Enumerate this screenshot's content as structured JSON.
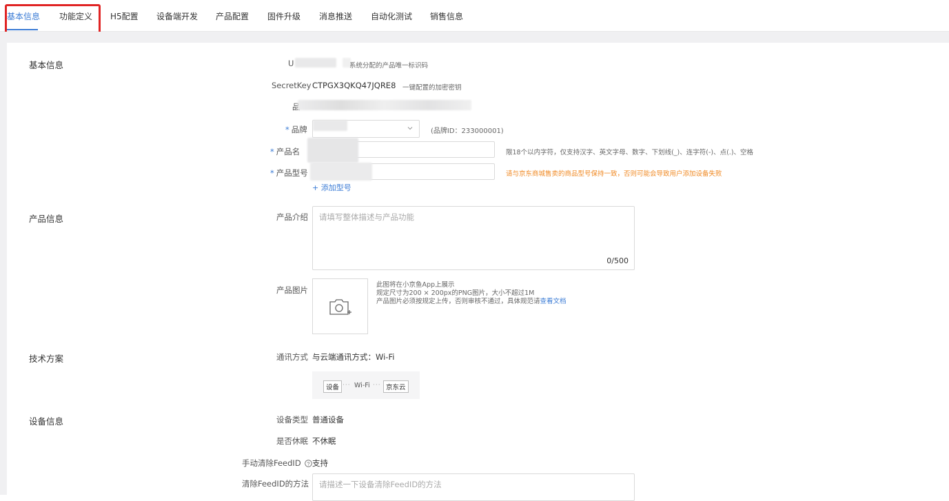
{
  "tabs": [
    {
      "label": "基本信息",
      "active": true
    },
    {
      "label": "功能定义"
    },
    {
      "label": "H5配置"
    },
    {
      "label": "设备端开发"
    },
    {
      "label": "产品配置"
    },
    {
      "label": "固件升级"
    },
    {
      "label": "消息推送"
    },
    {
      "label": "自动化测试"
    },
    {
      "label": "销售信息"
    }
  ],
  "sections": {
    "basic": "基本信息",
    "product": "产品信息",
    "tech": "技术方案",
    "device": "设备信息"
  },
  "basic": {
    "uuid_label": "U",
    "uuid_hint": "系统分配的产品唯一标识码",
    "secret_label": "SecretKey",
    "secret_value": "CTPGX3QKQ47JQRE8",
    "secret_hint": "一键配置的加密密钥",
    "category_label": "品",
    "brand_required": "*",
    "brand_label": "品牌",
    "brand_id": "(品牌ID：233000001)",
    "name_required": "*",
    "name_label": "产品名",
    "name_hint": "限18个以内字符，仅支持汉字、英文字母、数字、下划线(_)、连字符(-)、点(.)、空格",
    "model_required": "*",
    "model_label": "产品型号",
    "model_hint": "请与京东商城售卖的商品型号保持一致，否则可能会导致用户添加设备失败",
    "add_model": "+ 添加型号"
  },
  "product": {
    "intro_label": "产品介绍",
    "intro_placeholder": "请填写整体描述与产品功能",
    "intro_counter": "0/500",
    "image_label": "产品图片",
    "image_hint_1": "此图将在小京鱼App上展示",
    "image_hint_2": "规定尺寸为200 × 200px的PNG图片，大小不超过1M",
    "image_hint_3": "产品图片必须按规定上传，否则审核不通过，具体规范请",
    "image_hint_link": "查看文档"
  },
  "tech": {
    "comm_label": "通讯方式",
    "comm_value": "与云端通讯方式：Wi-Fi",
    "flow_device": "设备",
    "flow_wifi": "Wi-Fi",
    "flow_cloud": "京东云"
  },
  "device": {
    "type_label": "设备类型",
    "type_value": "普通设备",
    "sleep_label": "是否休眠",
    "sleep_value": "不休眠",
    "feedid_label": "手动清除FeedID",
    "feedid_value": "支持",
    "method_label": "清除FeedID的方法",
    "method_placeholder": "请描述一下设备清除FeedID的方法"
  },
  "colors": {
    "accent": "#3a7bd5",
    "highlight": "#e02424",
    "warning": "#f08a24"
  }
}
